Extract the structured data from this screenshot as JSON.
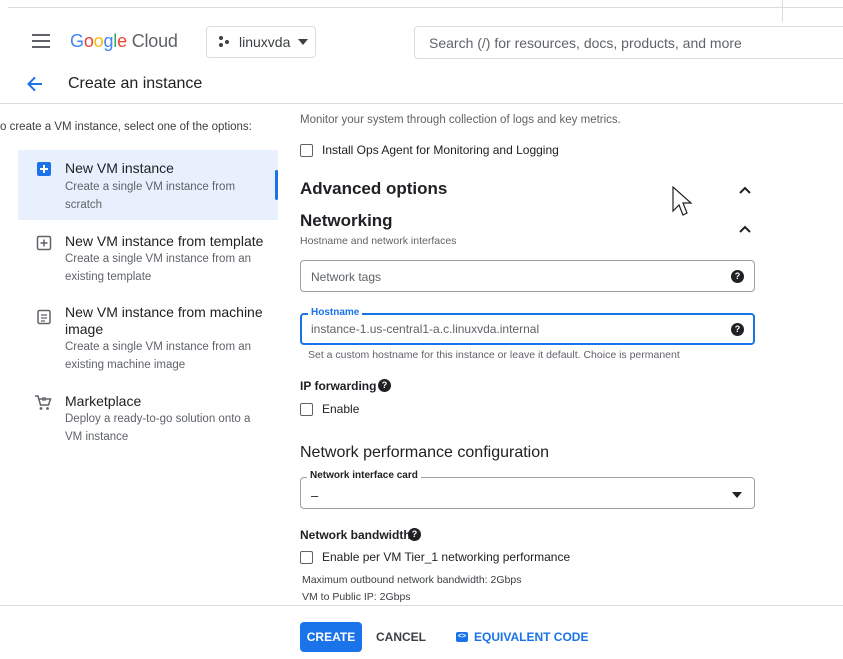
{
  "topbar": {
    "logo_google": [
      "G",
      "o",
      "o",
      "g",
      "l",
      "e"
    ],
    "logo_cloud": "Cloud",
    "project": "linuxvda",
    "search_placeholder": "Search (/) for resources, docs, products, and more"
  },
  "header": {
    "title": "Create an instance"
  },
  "left": {
    "intro": "o create a VM instance, select one of the options:",
    "options": [
      {
        "title": "New VM instance",
        "desc": [
          "Create a single VM instance from",
          "scratch"
        ],
        "icon": "add-box-icon"
      },
      {
        "title": "New VM instance from template",
        "desc": [
          "Create a single VM instance from an",
          "existing template"
        ],
        "icon": "template-icon"
      },
      {
        "title": [
          "New VM instance from machine",
          "image"
        ],
        "desc": [
          "Create a single VM instance from an",
          "existing machine image"
        ],
        "icon": "machine-image-icon"
      },
      {
        "title": "Marketplace",
        "desc": [
          "Deploy a ready-to-go solution onto a",
          "VM instance"
        ],
        "icon": "cart-icon"
      }
    ]
  },
  "content": {
    "monitor_text": "Monitor your system through collection of logs and key metrics.",
    "ops_agent_label": "Install Ops Agent for Monitoring and Logging",
    "advanced_title": "Advanced options",
    "networking_title": "Networking",
    "networking_sub": "Hostname and network interfaces",
    "network_tags_placeholder": "Network tags",
    "hostname_label": "Hostname",
    "hostname_placeholder": "instance-1.us-central1-a.c.linuxvda.internal",
    "hostname_help": "Set a custom hostname for this instance or leave it default. Choice is permanent",
    "ip_forwarding_label": "IP forwarding",
    "enable_label": "Enable",
    "perf_title": "Network performance configuration",
    "nic_label": "Network interface card",
    "nic_value": "–",
    "bandwidth_label": "Network bandwidth",
    "tier1_label": "Enable per VM Tier_1 networking performance",
    "max_bandwidth": "Maximum outbound network bandwidth: 2Gbps",
    "vm_public": "VM to Public IP: 2Gbps"
  },
  "footer": {
    "create": "CREATE",
    "cancel": "CANCEL",
    "equivalent": "EQUIVALENT CODE"
  },
  "colors": {
    "accent": "#1a73e8",
    "selected_bg": "#e8f0fe"
  }
}
